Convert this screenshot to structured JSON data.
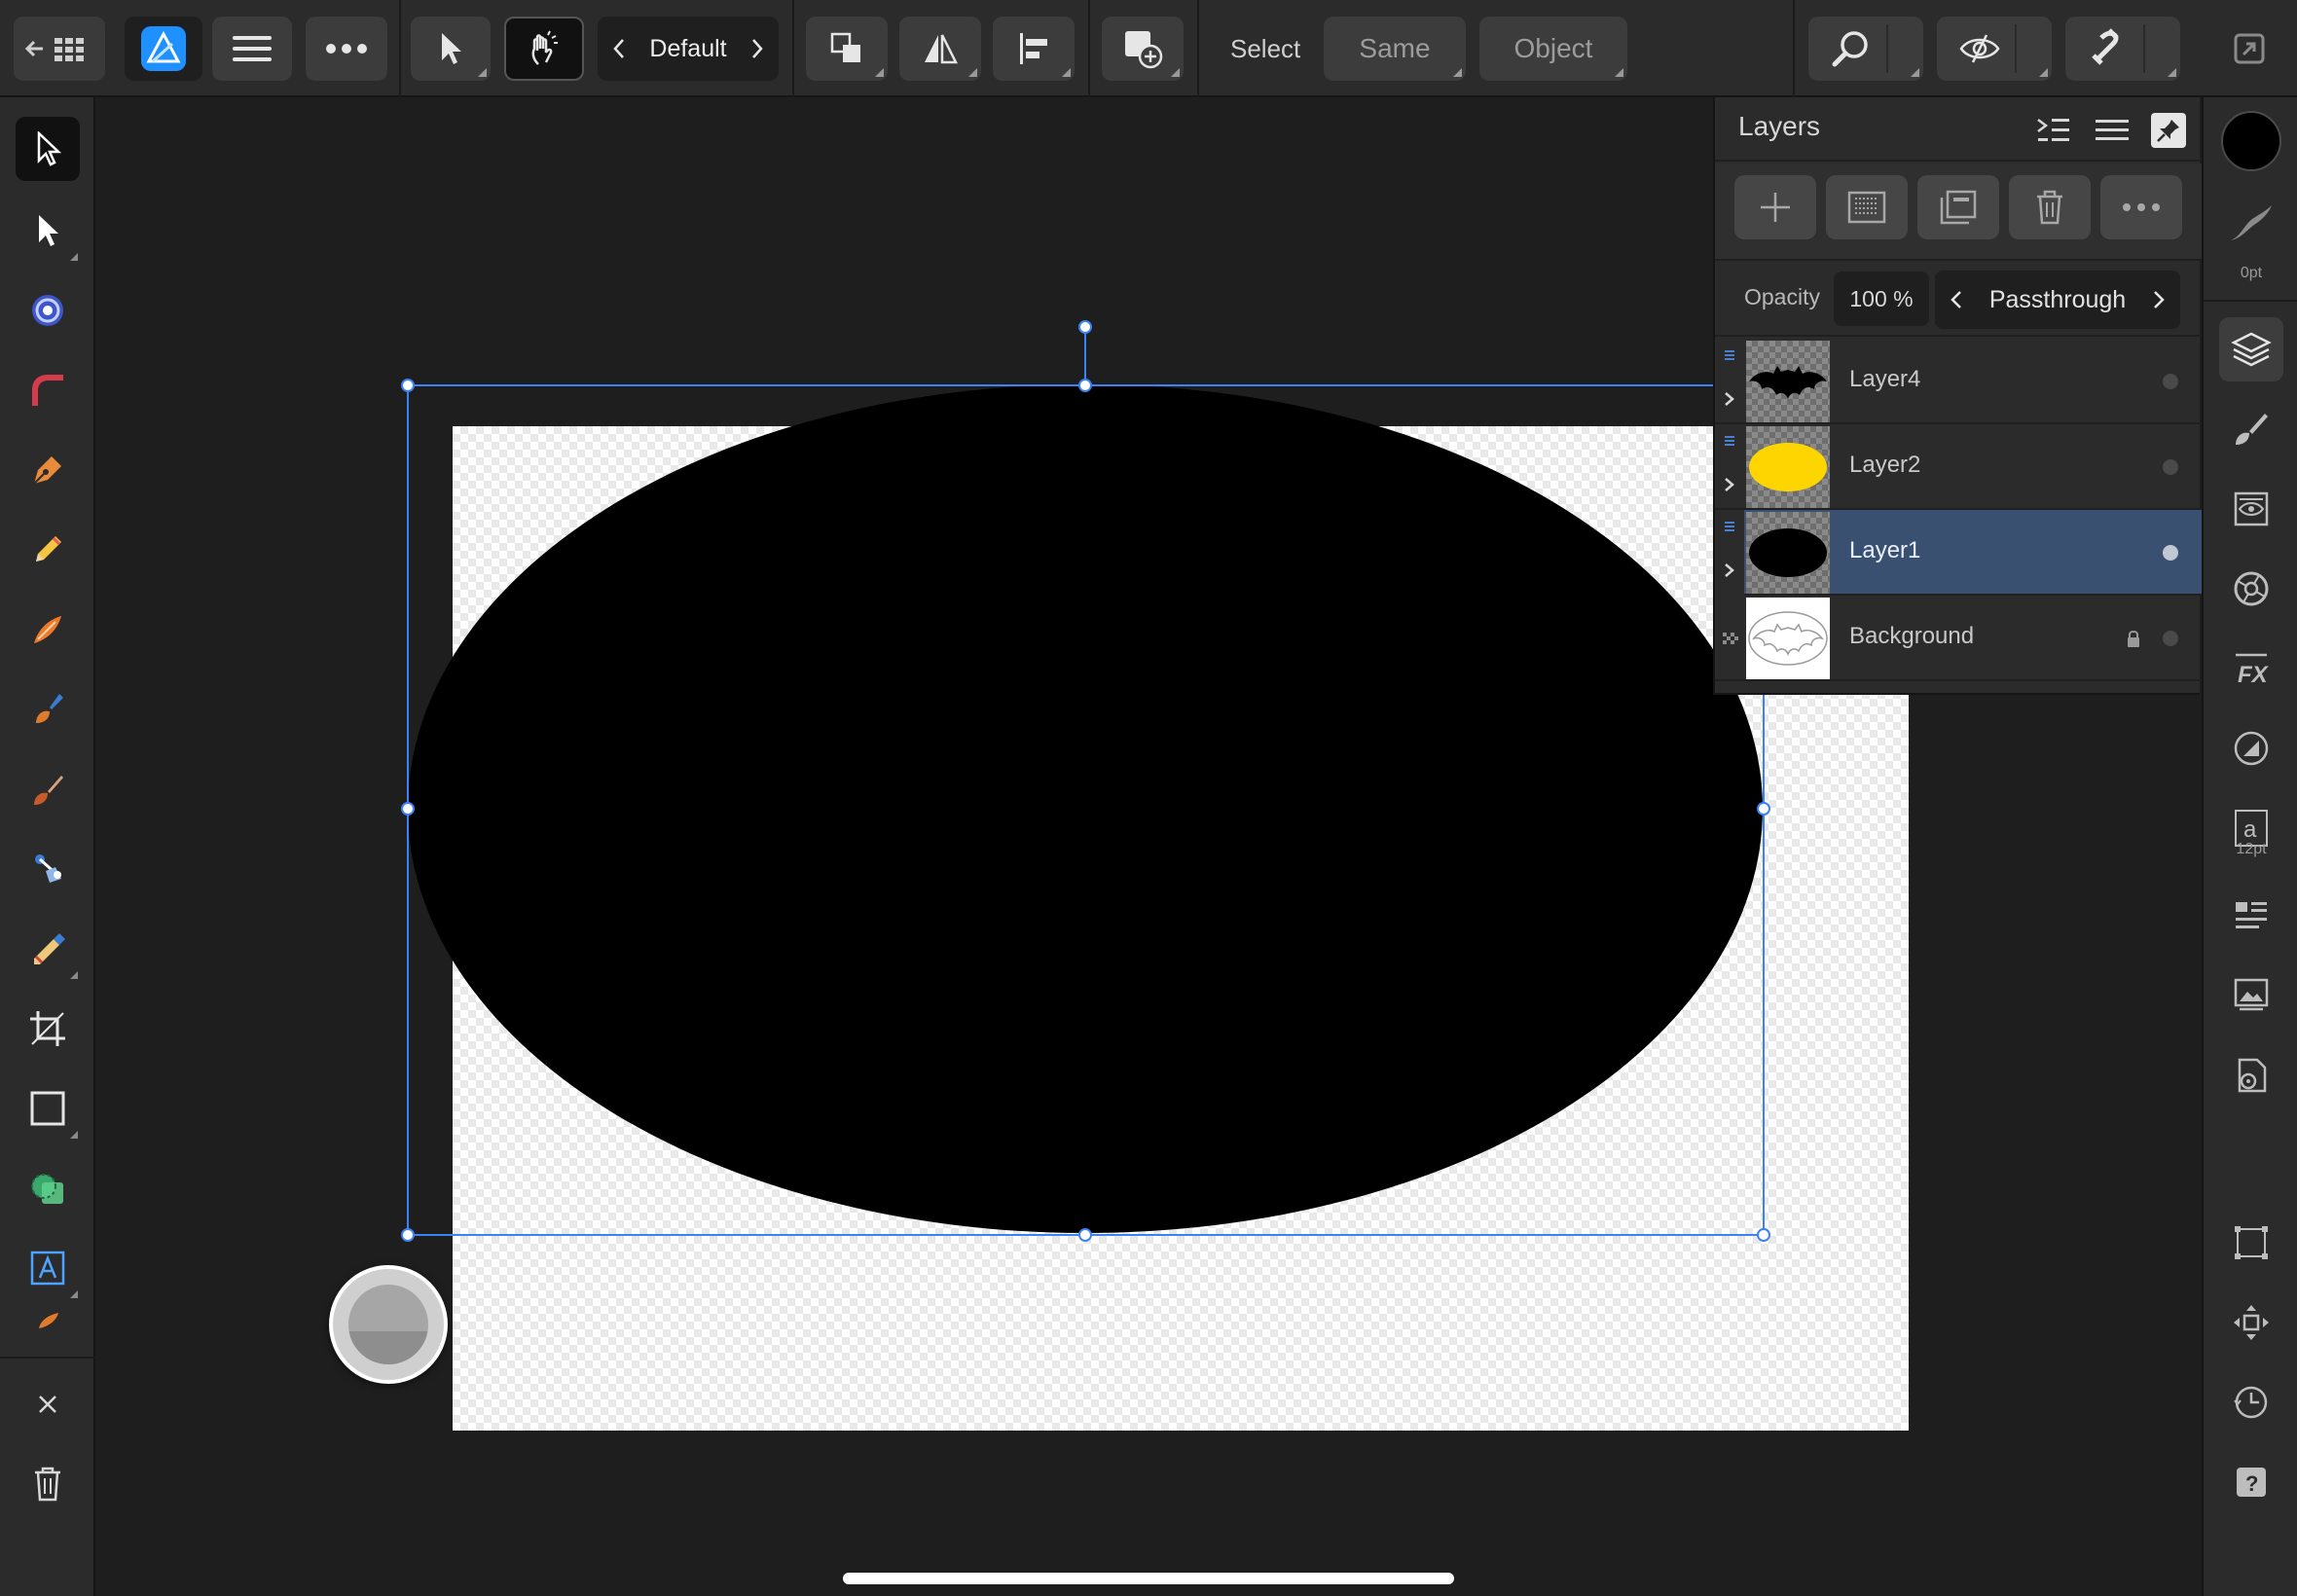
{
  "toolbar": {
    "persona_preset": "Default",
    "select_label": "Select",
    "same_label": "Same",
    "object_label": "Object"
  },
  "layers_panel": {
    "title": "Layers",
    "opacity_label": "Opacity",
    "opacity_value": "100 %",
    "blend_mode": "Passthrough",
    "layers": [
      {
        "name": "Layer4",
        "thumbnail": "bat-symbol-black",
        "selected": false,
        "locked": false
      },
      {
        "name": "Layer2",
        "thumbnail": "yellow-ellipse",
        "selected": false,
        "locked": false
      },
      {
        "name": "Layer1",
        "thumbnail": "black-ellipse",
        "selected": true,
        "locked": false
      },
      {
        "name": "Background",
        "thumbnail": "bat-logo-outline",
        "selected": false,
        "locked": true
      }
    ]
  },
  "studio": {
    "stroke_width": "0pt",
    "text_size": "12pt"
  },
  "canvas": {
    "selected_object": "black ellipse",
    "ellipse_fill": "#000000",
    "selection_color": "#3b82f6"
  },
  "colors": {
    "selected_layer_row": "#3a5070",
    "accent": "#3b82f6",
    "app_icon": "#1e90ff"
  }
}
